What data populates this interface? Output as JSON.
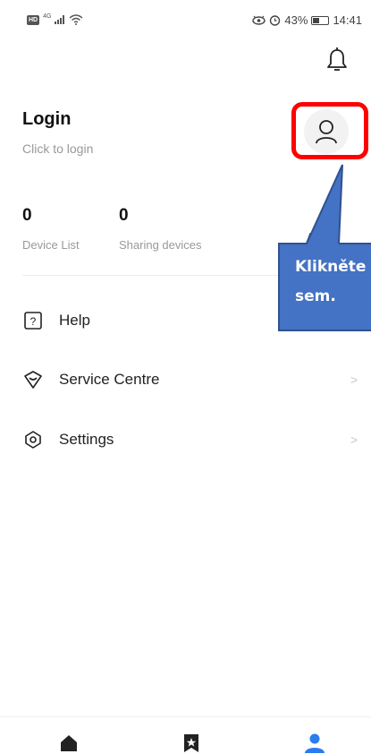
{
  "status_bar": {
    "hd_label": "HD",
    "network_label": "4G",
    "battery_text": "43%",
    "battery_level": 0.43,
    "time": "14:41",
    "icons": [
      "signal-icon",
      "wifi-icon",
      "eye-icon",
      "alarm-icon",
      "battery-icon"
    ]
  },
  "header": {
    "icon": "bell-icon"
  },
  "profile": {
    "title": "Login",
    "subtitle": "Click to login",
    "avatar_icon": "user-icon"
  },
  "stats": [
    {
      "value": "0",
      "label": "Device List"
    },
    {
      "value": "0",
      "label": "Sharing devices"
    }
  ],
  "menu": [
    {
      "label": "Help",
      "icon": "question-icon",
      "has_arrow": false
    },
    {
      "label": "Service Centre",
      "icon": "heart-shield-icon",
      "has_arrow": true
    },
    {
      "label": "Settings",
      "icon": "settings-icon",
      "has_arrow": true
    }
  ],
  "arrow_glyph": ">",
  "annotation": {
    "line1": "Klikněte",
    "line2": "sem.",
    "highlight_color": "#ff0000",
    "callout_color": "#4472c4"
  },
  "bottom_nav": [
    {
      "icon": "home-icon",
      "active": false
    },
    {
      "icon": "bookmark-star-icon",
      "active": false
    },
    {
      "icon": "person-icon",
      "active": true
    }
  ],
  "colors": {
    "active": "#2a7cf0",
    "inactive": "#222222"
  }
}
